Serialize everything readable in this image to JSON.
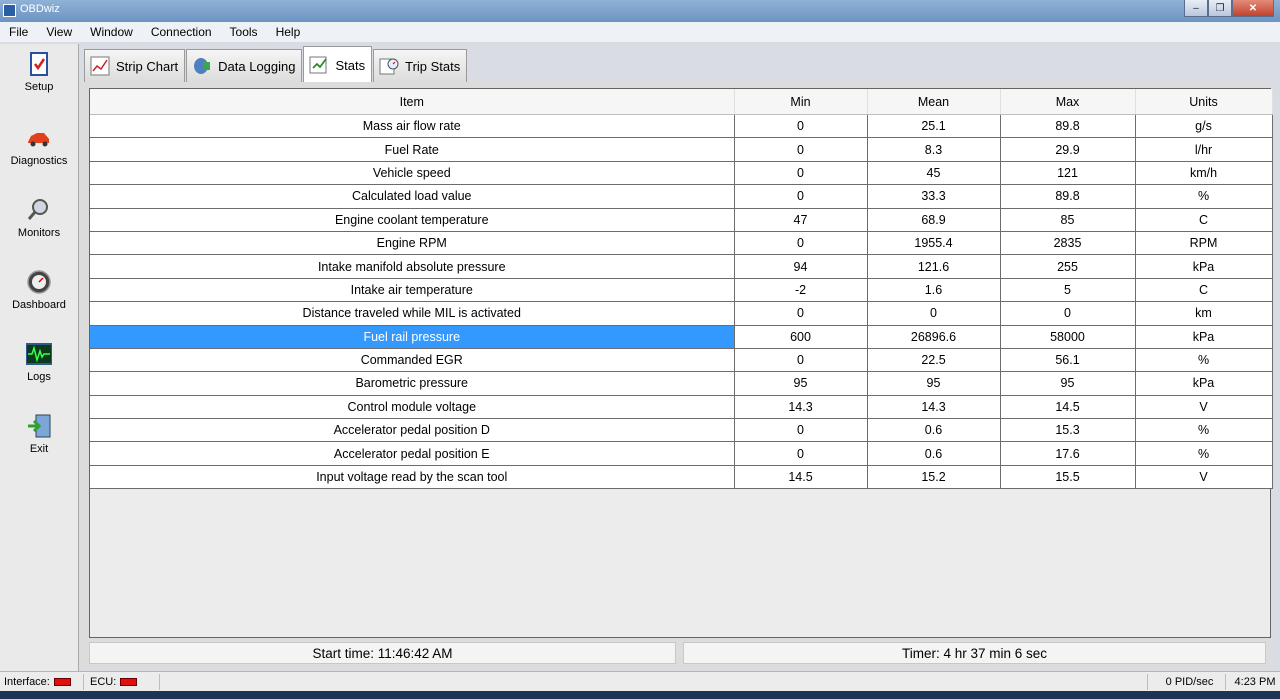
{
  "window": {
    "title": "OBDwiz"
  },
  "menu": [
    "File",
    "View",
    "Window",
    "Connection",
    "Tools",
    "Help"
  ],
  "sidebar": [
    {
      "label": "Setup",
      "icon": "clipboard-check-icon"
    },
    {
      "label": "Diagnostics",
      "icon": "car-icon"
    },
    {
      "label": "Monitors",
      "icon": "magnifier-icon"
    },
    {
      "label": "Dashboard",
      "icon": "gauge-icon"
    },
    {
      "label": "Logs",
      "icon": "waveform-icon"
    },
    {
      "label": "Exit",
      "icon": "exit-door-icon"
    }
  ],
  "tabs": [
    {
      "label": "Strip Chart",
      "icon": "strip-chart-icon"
    },
    {
      "label": "Data Logging",
      "icon": "data-logging-icon"
    },
    {
      "label": "Stats",
      "icon": "stats-icon",
      "active": true
    },
    {
      "label": "Trip Stats",
      "icon": "trip-stats-icon"
    }
  ],
  "table": {
    "headers": [
      "Item",
      "Min",
      "Mean",
      "Max",
      "Units"
    ],
    "rows": [
      [
        "Mass air flow rate",
        "0",
        "25.1",
        "89.8",
        "g/s"
      ],
      [
        "Fuel Rate",
        "0",
        "8.3",
        "29.9",
        "l/hr"
      ],
      [
        "Vehicle speed",
        "0",
        "45",
        "121",
        "km/h"
      ],
      [
        "Calculated load value",
        "0",
        "33.3",
        "89.8",
        "%"
      ],
      [
        "Engine coolant temperature",
        "47",
        "68.9",
        "85",
        "C"
      ],
      [
        "Engine RPM",
        "0",
        "1955.4",
        "2835",
        "RPM"
      ],
      [
        "Intake manifold absolute pressure",
        "94",
        "121.6",
        "255",
        "kPa"
      ],
      [
        "Intake air temperature",
        "-2",
        "1.6",
        "5",
        "C"
      ],
      [
        "Distance traveled while MIL is activated",
        "0",
        "0",
        "0",
        "km"
      ],
      [
        "Fuel rail pressure",
        "600",
        "26896.6",
        "58000",
        "kPa"
      ],
      [
        "Commanded EGR",
        "0",
        "22.5",
        "56.1",
        "%"
      ],
      [
        "Barometric pressure",
        "95",
        "95",
        "95",
        "kPa"
      ],
      [
        "Control module voltage",
        "14.3",
        "14.3",
        "14.5",
        "V"
      ],
      [
        "Accelerator pedal position D",
        "0",
        "0.6",
        "15.3",
        "%"
      ],
      [
        "Accelerator pedal position E",
        "0",
        "0.6",
        "17.6",
        "%"
      ],
      [
        "Input voltage read by the scan tool",
        "14.5",
        "15.2",
        "15.5",
        "V"
      ]
    ],
    "selected_row": 9
  },
  "status": {
    "start_time": "Start time: 11:46:42 AM",
    "timer": "Timer: 4 hr 37 min 6 sec"
  },
  "bottom": {
    "interface_label": "Interface:",
    "ecu_label": "ECU:",
    "pid_rate": "0 PID/sec",
    "clock": "4:23 PM"
  },
  "colors": {
    "selection": "#3399ff",
    "led_off": "#e01010"
  }
}
